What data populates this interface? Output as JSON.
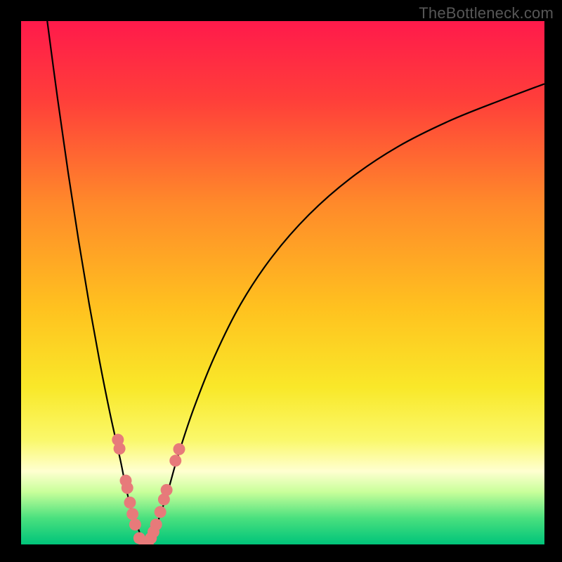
{
  "watermark": "TheBottleneck.com",
  "chart_data": {
    "type": "line",
    "title": "",
    "xlabel": "",
    "ylabel": "",
    "xlim": [
      0,
      100
    ],
    "ylim": [
      0,
      100
    ],
    "gradient_stops": [
      {
        "pct": 0,
        "color": "#ff1a4b"
      },
      {
        "pct": 15,
        "color": "#ff3e3a"
      },
      {
        "pct": 35,
        "color": "#ff8a2a"
      },
      {
        "pct": 55,
        "color": "#ffc21f"
      },
      {
        "pct": 70,
        "color": "#f9e829"
      },
      {
        "pct": 80,
        "color": "#faf86a"
      },
      {
        "pct": 86,
        "color": "#ffffd0"
      },
      {
        "pct": 90,
        "color": "#c8ff9a"
      },
      {
        "pct": 95,
        "color": "#49e07e"
      },
      {
        "pct": 100,
        "color": "#00c47a"
      }
    ],
    "series": [
      {
        "name": "left-branch",
        "x": [
          5,
          7,
          9,
          11,
          13,
          15,
          17,
          19,
          20,
          21,
          22,
          23,
          24
        ],
        "y": [
          100,
          85,
          71,
          58,
          46,
          35,
          25,
          16,
          11,
          7,
          4,
          1.5,
          0
        ]
      },
      {
        "name": "right-branch",
        "x": [
          24,
          25,
          26,
          28,
          30,
          33,
          37,
          42,
          48,
          55,
          63,
          72,
          82,
          92,
          100
        ],
        "y": [
          0,
          1.5,
          4,
          10,
          17,
          26,
          36,
          46,
          55,
          63,
          70,
          76,
          81,
          85,
          88
        ]
      }
    ],
    "markers": {
      "name": "pink-dots",
      "color": "#e77a7a",
      "points_x": [
        18.5,
        18.8,
        20.0,
        20.3,
        20.8,
        21.3,
        21.8,
        22.6,
        23.6,
        24.2,
        24.8,
        25.3,
        25.8,
        26.6,
        27.3,
        27.8,
        29.5,
        30.2
      ],
      "points_y": [
        20.0,
        18.3,
        12.2,
        10.8,
        8.0,
        5.8,
        3.8,
        1.2,
        0.2,
        0.2,
        1.2,
        2.4,
        3.8,
        6.2,
        8.6,
        10.4,
        16.0,
        18.2
      ]
    }
  }
}
